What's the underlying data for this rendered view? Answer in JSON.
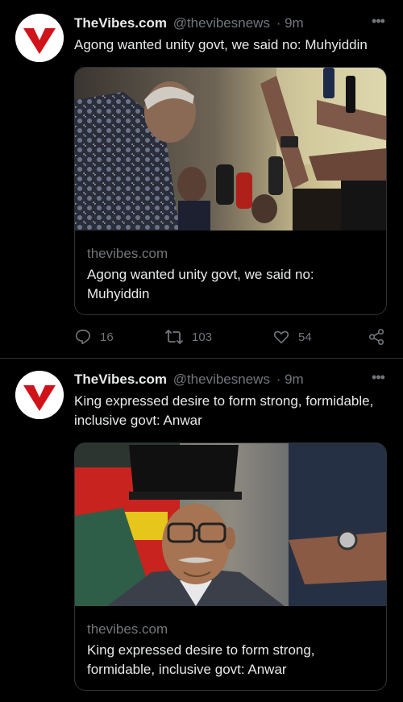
{
  "tweets": [
    {
      "author_name": "TheVibes.com",
      "author_handle": "@thevibesnews",
      "time": "· 9m",
      "text": "Agong wanted unity govt, we said no: Muhyiddin",
      "card": {
        "domain": "thevibes.com",
        "title": "Agong wanted unity govt, we said no: Muhyiddin"
      },
      "actions": {
        "replies": "16",
        "retweets": "103",
        "likes": "54"
      }
    },
    {
      "author_name": "TheVibes.com",
      "author_handle": "@thevibesnews",
      "time": "· 9m",
      "text": "King expressed desire to form strong, formidable, inclusive govt: Anwar",
      "card": {
        "domain": "thevibes.com",
        "title": "King expressed desire to form strong, formidable, inclusive govt: Anwar"
      }
    }
  ],
  "more_label": "•••",
  "colors": {
    "background": "#000000",
    "brand_red": "#d0121b",
    "secondary_text": "#71767b",
    "primary_text": "#e7e9ea"
  }
}
